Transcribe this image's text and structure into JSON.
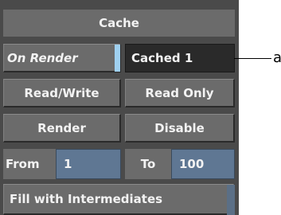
{
  "panel": {
    "title": "Cache",
    "on_render": {
      "label": "On Render"
    },
    "cache_status": {
      "value": "Cached 1"
    },
    "access_mode": {
      "read_write": "Read/Write",
      "read_only": "Read Only"
    },
    "render_mode": {
      "render": "Render",
      "disable": "Disable"
    },
    "range": {
      "from_label": "From",
      "from_value": "1",
      "to_label": "To",
      "to_value": "100"
    },
    "fill_option": {
      "label": "Fill with Intermediates"
    }
  },
  "callout": {
    "label": "a"
  },
  "colors": {
    "panel_bg": "#4a4a4a",
    "button_bg": "#6b6b6b",
    "field_bg": "#5f7793",
    "indicator": "#9fd0f0",
    "dark_field": "#2a2a2a"
  }
}
